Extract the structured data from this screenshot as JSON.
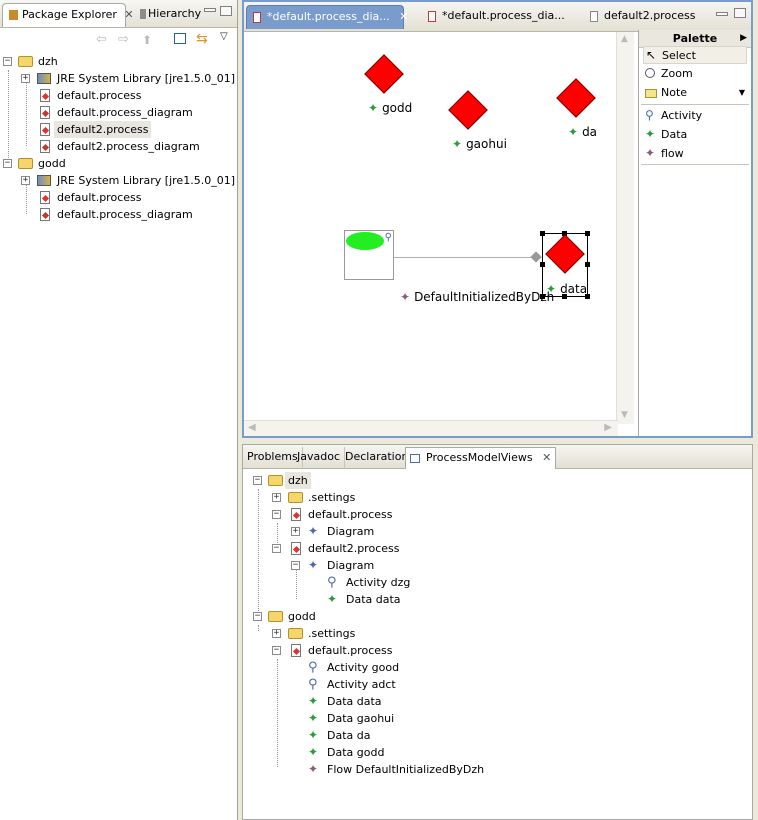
{
  "left": {
    "tabs": [
      "Package Explorer",
      "Hierarchy"
    ],
    "tree": [
      {
        "label": "dzh"
      },
      {
        "label": "JRE System Library [jre1.5.0_01]"
      },
      {
        "label": "default.process"
      },
      {
        "label": "default.process_diagram"
      },
      {
        "label": "default2.process"
      },
      {
        "label": "default2.process_diagram"
      },
      {
        "label": "godd"
      },
      {
        "label": "JRE System Library [jre1.5.0_01]"
      },
      {
        "label": "default.process"
      },
      {
        "label": "default.process_diagram"
      }
    ]
  },
  "editor": {
    "tabs": [
      "*default.process_dia...",
      "*default.process_dia...",
      "default2.process"
    ],
    "nodes": {
      "godd": "godd",
      "gaohui": "gaohui",
      "da": "da",
      "data": "data",
      "flow": "DefaultInitializedByDzh"
    },
    "palette": {
      "title": "Palette",
      "items": [
        "Select",
        "Zoom",
        "Note",
        "Activity",
        "Data",
        "flow"
      ]
    }
  },
  "bottom": {
    "tabs": [
      "Problems",
      "Javadoc",
      "Declaration",
      "ProcessModelViews"
    ],
    "tree": [
      {
        "label": "dzh"
      },
      {
        "label": ".settings"
      },
      {
        "label": "default.process"
      },
      {
        "label": "Diagram"
      },
      {
        "label": "default2.process"
      },
      {
        "label": "Diagram"
      },
      {
        "label": "Activity dzg"
      },
      {
        "label": "Data data"
      },
      {
        "label": "godd"
      },
      {
        "label": ".settings"
      },
      {
        "label": "default.process"
      },
      {
        "label": "Activity good"
      },
      {
        "label": "Activity adct"
      },
      {
        "label": "Data data"
      },
      {
        "label": "Data gaohui"
      },
      {
        "label": "Data da"
      },
      {
        "label": "Data godd"
      },
      {
        "label": "Flow DefaultInitializedByDzh"
      }
    ]
  },
  "colors": {
    "diamond": "#ff0000",
    "activity_fill": "#22ee22",
    "accent": "#7a9ccc"
  }
}
